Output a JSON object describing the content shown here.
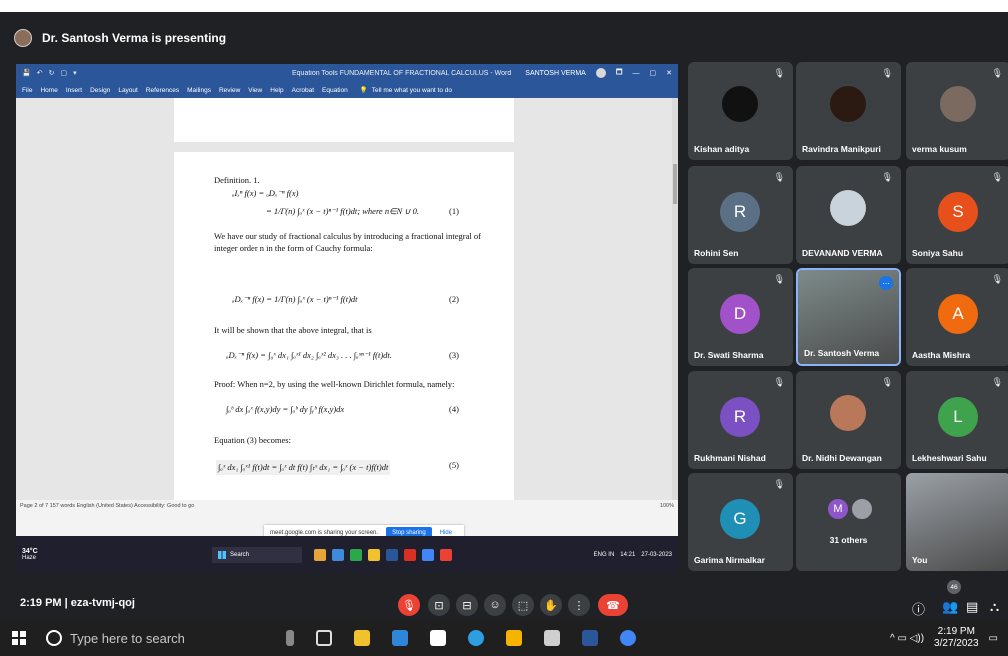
{
  "presenting": {
    "text": "Dr. Santosh Verma is presenting"
  },
  "word": {
    "quick_access": [
      "💾",
      "↶",
      "↻",
      "▢",
      "▾"
    ],
    "title": "Equation Tools  FUNDAMENTAL OF FRACTIONAL CALCULUS - Word",
    "user": "SANTOSH VERMA",
    "window_controls": [
      "🗖",
      "—",
      "▢",
      "✕"
    ],
    "menu": [
      "File",
      "Home",
      "Insert",
      "Design",
      "Layout",
      "References",
      "Mailings",
      "Review",
      "View",
      "Help",
      "Acrobat",
      "Equation"
    ],
    "tell_me": "Tell me what you want to do",
    "status_left": "Page 2 of 7   157 words   English (United States)   Accessibility: Good to go",
    "status_zoom": "100%"
  },
  "doc": {
    "definition": "Definition. 1.",
    "eq1a": "ₐIₓⁿ f(x) = ₐDₓ⁻ⁿ f(x)",
    "eq1b": "= 1/Γ(n) ∫ₐˣ (x − t)ⁿ⁻¹ f(t)dt;   where n∈N ∪ 0.",
    "eq1_num": "(1)",
    "para1": "We have our study of fractional calculus by introducing a fractional integral of integer order n in the form of Cauchy formula:",
    "eq2": "ₐDₓ⁻ⁿ f(x) = 1/Γ(n) ∫ₐˣ (x − t)ⁿ⁻¹ f(t)dt",
    "eq2_num": "(2)",
    "para2": "It will be shown that the above integral, that is",
    "eq3": "ₐDₓ⁻ⁿ f(x) = ∫₀ˣ dx₁ ∫ₐˣ¹ dx₂ ∫ₐˣ² dx₃ . . . ∫ₐˣⁿ⁻¹ f(t)dt.",
    "eq3_num": "(3)",
    "para3": "Proof: When n=2, by using the well-known Dirichlet formula, namely:",
    "eq4": "∫ₐᵇ dx ∫ₐˣ f(x,y)dy = ∫ₐᵇ dy ∫ᵧᵇ f(x,y)dx",
    "eq4_num": "(4)",
    "para4": "Equation (3) becomes:",
    "eq5": "∫ₐˣ dx₁ ∫ₐˣ¹ f(t)dt = ∫ₐˣ dt f(t) ∫ₜˣ dx₁ = ∫ₐˣ (x − t)f(t)dt",
    "eq5_num": "(5)"
  },
  "share_notice": {
    "text": "meet.google.com is sharing your screen.",
    "stop": "Stop sharing",
    "hide": "Hide"
  },
  "inner_taskbar": {
    "temp": "34°C",
    "weather": "Haze",
    "search": "Search",
    "lang": "ENG IN",
    "time": "14:21",
    "date": "27-03-2023"
  },
  "participants": [
    {
      "name": "Kishan aditya",
      "type": "photo",
      "color": "#111111"
    },
    {
      "name": "Ravindra Manikpuri",
      "type": "photo",
      "color": "#2a1a12"
    },
    {
      "name": "verma kusum",
      "type": "photo",
      "color": "#7a6a60"
    },
    {
      "name": "Rohini Sen",
      "type": "initial",
      "initial": "R",
      "color": "#5c7085"
    },
    {
      "name": "DEVANAND VERMA",
      "type": "photo",
      "color": "#c9d3dc"
    },
    {
      "name": "Soniya Sahu",
      "type": "initial",
      "initial": "S",
      "color": "#e8501b"
    },
    {
      "name": "Dr. Swati Sharma",
      "type": "initial",
      "initial": "D",
      "color": "#a152c8"
    },
    {
      "name": "Dr. Santosh Verma",
      "type": "video",
      "color": "#7d8b8a"
    },
    {
      "name": "Aastha Mishra",
      "type": "initial",
      "initial": "A",
      "color": "#f06a0f"
    },
    {
      "name": "Rukhmani Nishad",
      "type": "initial",
      "initial": "R",
      "color": "#7b50c2"
    },
    {
      "name": "Dr. Nidhi Dewangan",
      "type": "photo",
      "color": "#b9785a"
    },
    {
      "name": "Lekheshwari Sahu",
      "type": "initial",
      "initial": "L",
      "color": "#3fa34d"
    },
    {
      "name": "Garima Nirmalkar",
      "type": "initial",
      "initial": "G",
      "color": "#1f8fb6"
    },
    {
      "name": "31 others",
      "type": "others",
      "initial": "M",
      "color": "#8e57c9"
    },
    {
      "name": "You",
      "type": "video",
      "color": "#9aa0a6"
    }
  ],
  "meeting": {
    "time": "2:19 PM",
    "separator": "|",
    "code": "eza-tvmj-qoj",
    "participant_count": "46",
    "controls": [
      "🎙",
      "⊡",
      "⊟",
      "☺",
      "⬚",
      "✋",
      "⋮",
      "☎"
    ],
    "right_controls": [
      "ⓘ",
      "👥",
      "▤",
      "⛬"
    ]
  },
  "taskbar": {
    "search_placeholder": "Type here to search",
    "time": "2:19 PM",
    "date": "3/27/2023",
    "tray": "^  ▭  ◁))"
  }
}
